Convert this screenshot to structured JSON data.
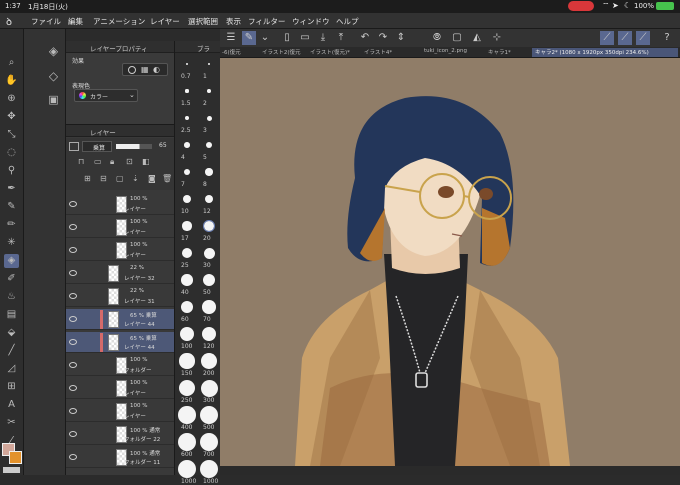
{
  "status": {
    "time": "1:37",
    "date": "1月18日(火)",
    "battery": "100%"
  },
  "menu": [
    "ファイル",
    "編集",
    "アニメーション",
    "レイヤー",
    "選択範囲",
    "表示",
    "フィルター",
    "ウィンドウ",
    "ヘルプ"
  ],
  "prop": {
    "title": "レイヤープロパティ",
    "effect_label": "効果",
    "expr_label": "表現色",
    "color_value": "カラー"
  },
  "layers": {
    "title": "レイヤー",
    "blend": "乗算",
    "opacity": "65",
    "rows": [
      {
        "pct": "100 %",
        "name": "レイヤー"
      },
      {
        "pct": "100 %",
        "name": "レイヤー"
      },
      {
        "pct": "100 %",
        "name": "レイヤー"
      },
      {
        "pct": "22 %",
        "name": "レイヤー 32"
      },
      {
        "pct": "22 %",
        "name": "レイヤー 31"
      },
      {
        "pct": "65 % 乗算",
        "name": "レイヤー 44"
      },
      {
        "pct": "65 % 乗算",
        "name": "レイヤー 44"
      },
      {
        "pct": "100 %",
        "name": "フォルダー"
      },
      {
        "pct": "100 %",
        "name": "レイヤー"
      },
      {
        "pct": "100 %",
        "name": "レイヤー"
      },
      {
        "pct": "100 % 通常",
        "name": "フォルダー 22"
      },
      {
        "pct": "100 % 通常",
        "name": "フォルダー 11"
      }
    ]
  },
  "sizes": {
    "title": "ブラ",
    "left": [
      "0.7",
      "1.5",
      "2.5",
      "4",
      "7",
      "10",
      "17",
      "25",
      "40",
      "60",
      "100",
      "150",
      "250",
      "400",
      "600",
      "1000"
    ],
    "right": [
      "1",
      "2",
      "3",
      "5",
      "8",
      "12",
      "20",
      "30",
      "50",
      "70",
      "120",
      "200",
      "300",
      "500",
      "700",
      "1000"
    ]
  },
  "tabs": [
    "-6(復元",
    "イラスト2(復元",
    "イラスト(復元)*",
    "イラスト4*",
    "tuki_icon_2.png",
    "キャラ1*",
    "キャラ2* (1080 x 1920px 350dpi 234.6%)"
  ]
}
